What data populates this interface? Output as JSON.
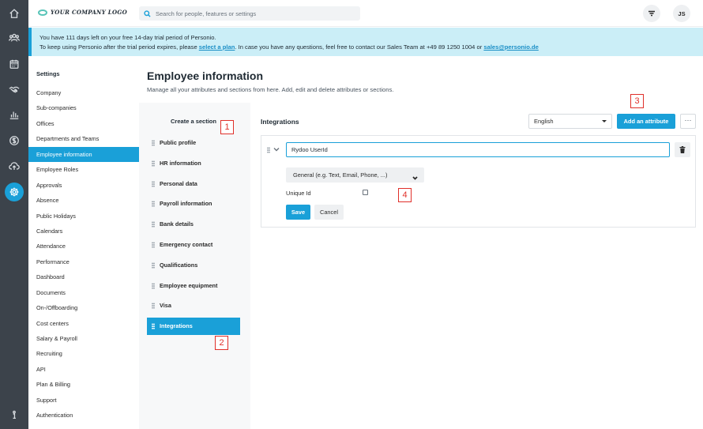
{
  "rail": {
    "icons": [
      "home-icon",
      "people-icon",
      "calendar-icon",
      "handshake-icon",
      "chart-icon",
      "money-icon",
      "cloud-upload-icon",
      "settings-gear-icon",
      "info-icon"
    ]
  },
  "header": {
    "logo_text": "YOUR COMPANY LOGO",
    "search_placeholder": "Search for people, features or settings",
    "avatar_initials": "JS"
  },
  "banner": {
    "line1": "You have 111 days left on your free 14-day trial period of Personio.",
    "line2_prefix": "To keep using Personio after the trial period expires, please ",
    "plan_link": "select a plan",
    "line2_middle": ". In case you have any questions, feel free to contact our Sales Team at +49 89 1250 1004 or ",
    "email_link": "sales@personio.de"
  },
  "settings": {
    "title": "Settings",
    "items": [
      "Company",
      "Sub-companies",
      "Offices",
      "Departments and Teams",
      "Employee information",
      "Employee Roles",
      "Approvals",
      "Absence",
      "Public Holidays",
      "Calendars",
      "Attendance",
      "Performance",
      "Dashboard",
      "Documents",
      "On-/Offboarding",
      "Cost centers",
      "Salary & Payroll",
      "Recruiting",
      "API",
      "Plan & Billing",
      "Support",
      "Authentication"
    ],
    "active_index": 4
  },
  "main": {
    "title": "Employee information",
    "subtitle": "Manage all your attributes and sections from here. Add, edit and delete attributes or sections.",
    "create_section_label": "Create a section",
    "sections": [
      "Public profile",
      "HR information",
      "Personal data",
      "Payroll information",
      "Bank details",
      "Emergency contact",
      "Qualifications",
      "Employee equipment",
      "Visa",
      "Integrations"
    ],
    "active_section_index": 9,
    "panel_title": "Integrations",
    "language_value": "English",
    "add_attribute_label": "Add an attribute",
    "more_label": "···",
    "attribute": {
      "name_value": "Rydoo UserId",
      "type_value": "General (e.g. Text, Email, Phone, ...)",
      "unique_label": "Unique Id",
      "save_label": "Save",
      "cancel_label": "Cancel"
    }
  },
  "annotations": {
    "m1": "1",
    "m2": "2",
    "m3": "3",
    "m4": "4",
    "color": "#e0302a"
  },
  "colors": {
    "accent": "#1aa0d8",
    "rail": "#3c434b",
    "banner_bg": "#cbeef7"
  }
}
